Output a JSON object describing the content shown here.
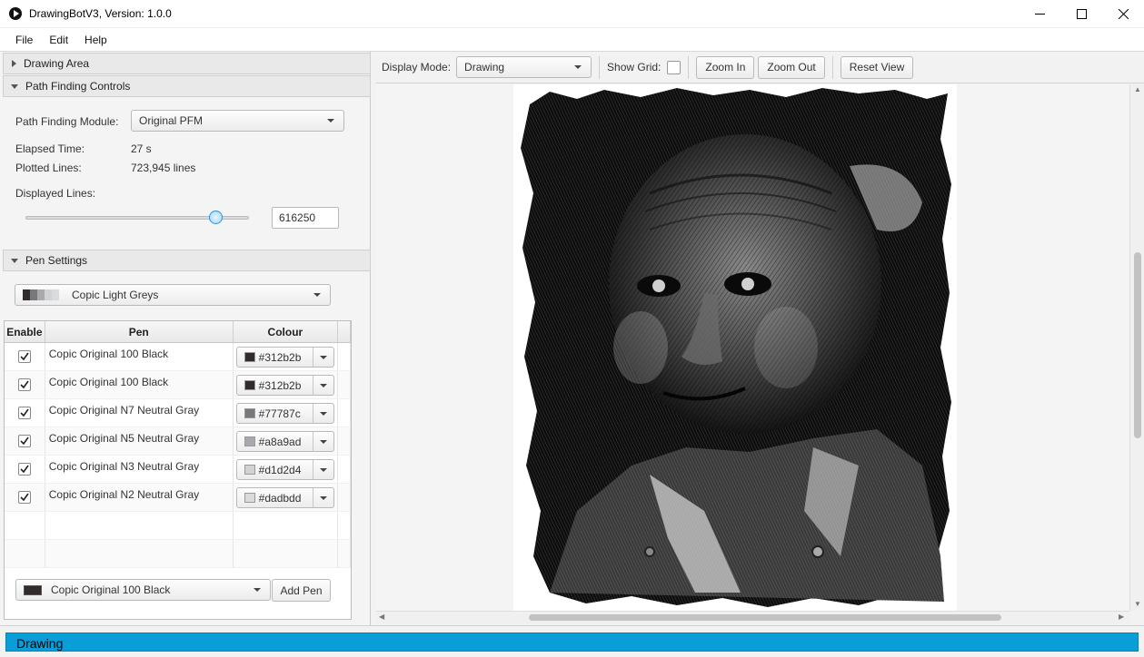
{
  "window": {
    "title": "DrawingBotV3, Version: 1.0.0"
  },
  "menu": {
    "items": [
      "File",
      "Edit",
      "Help"
    ]
  },
  "sidebar": {
    "drawing_area": {
      "label": "Drawing Area"
    },
    "path_finding": {
      "label": "Path Finding Controls",
      "module_label": "Path Finding Module:",
      "module_value": "Original PFM",
      "elapsed_label": "Elapsed Time:",
      "elapsed_value": "27 s",
      "plotted_label": "Plotted Lines:",
      "plotted_value": "723,945 lines",
      "displayed_label": "Displayed Lines:",
      "displayed_value": "616250",
      "slider_fraction": 0.85
    },
    "pen_settings": {
      "label": "Pen Settings",
      "set_value": "Copic Light Greys",
      "set_swatches": [
        "#312b2b",
        "#77787c",
        "#a8a9ad",
        "#d1d2d4",
        "#dadbdd"
      ],
      "columns": {
        "enable": "Enable",
        "pen": "Pen",
        "colour": "Colour"
      },
      "pens": [
        {
          "enabled": true,
          "name": "Copic Original 100 Black",
          "hex": "#312b2b"
        },
        {
          "enabled": true,
          "name": "Copic Original 100 Black",
          "hex": "#312b2b"
        },
        {
          "enabled": true,
          "name": "Copic Original N7 Neutral Gray",
          "hex": "#77787c"
        },
        {
          "enabled": true,
          "name": "Copic Original N5 Neutral Gray",
          "hex": "#a8a9ad"
        },
        {
          "enabled": true,
          "name": "Copic Original N3 Neutral Gray",
          "hex": "#d1d2d4"
        },
        {
          "enabled": true,
          "name": "Copic Original N2 Neutral Gray",
          "hex": "#dadbdd"
        }
      ],
      "add_pen_select": {
        "value": "Copic Original 100 Black",
        "swatch": "#312b2b"
      },
      "add_pen_label": "Add Pen"
    }
  },
  "toolbar": {
    "display_mode_label": "Display Mode:",
    "display_mode_value": "Drawing",
    "show_grid_label": "Show Grid:",
    "show_grid": false,
    "zoom_in_label": "Zoom In",
    "zoom_out_label": "Zoom Out",
    "reset_view_label": "Reset View"
  },
  "canvas": {
    "content": "pen-plotter-drawing",
    "background": "#ffffff"
  },
  "status": {
    "label": "Drawing",
    "progress_fraction": 1.0,
    "accent": "#0a9ed8"
  }
}
